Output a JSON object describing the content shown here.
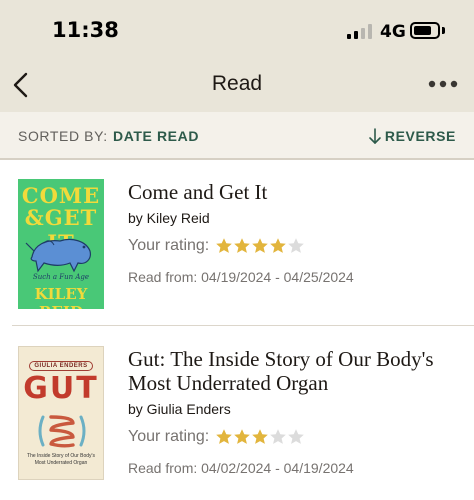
{
  "status_bar": {
    "time": "11:38",
    "network": "4G",
    "signal_bars_active": 2,
    "signal_bars_total": 4,
    "battery_level": 0.75
  },
  "nav": {
    "title": "Read",
    "back_icon": "chevron-left-icon",
    "more_icon": "more-horizontal-icon"
  },
  "sort": {
    "label": "SORTED BY:",
    "value": "DATE READ",
    "reverse_label": "REVERSE",
    "reverse_icon": "arrow-down-icon"
  },
  "colors": {
    "accent": "#2d5a4a",
    "header_bg": "#e9e5d9",
    "star_filled": "#e2b53d",
    "star_empty": "#dcdcdc"
  },
  "books": [
    {
      "title": "Come and Get It",
      "author": "by Kiley Reid",
      "rating_label": "Your rating:",
      "rating": 4,
      "rating_max": 5,
      "read_from": "Read from: 04/19/2024 - 04/25/2024",
      "cover": {
        "title_line_1": "COME",
        "title_line_2": "&GET IT",
        "subtitle": "Such a Fun Age",
        "author": "KILEY REID"
      }
    },
    {
      "title": "Gut: The Inside Story of Our Body's Most Underrated Organ",
      "author": "by Giulia Enders",
      "rating_label": "Your rating:",
      "rating": 3,
      "rating_max": 5,
      "read_from": "Read from: 04/02/2024 - 04/19/2024",
      "cover": {
        "author": "GIULIA ENDERS",
        "title": "GUT",
        "subtitle": "The Inside Story of Our Body's Most Underrated Organ"
      }
    }
  ]
}
